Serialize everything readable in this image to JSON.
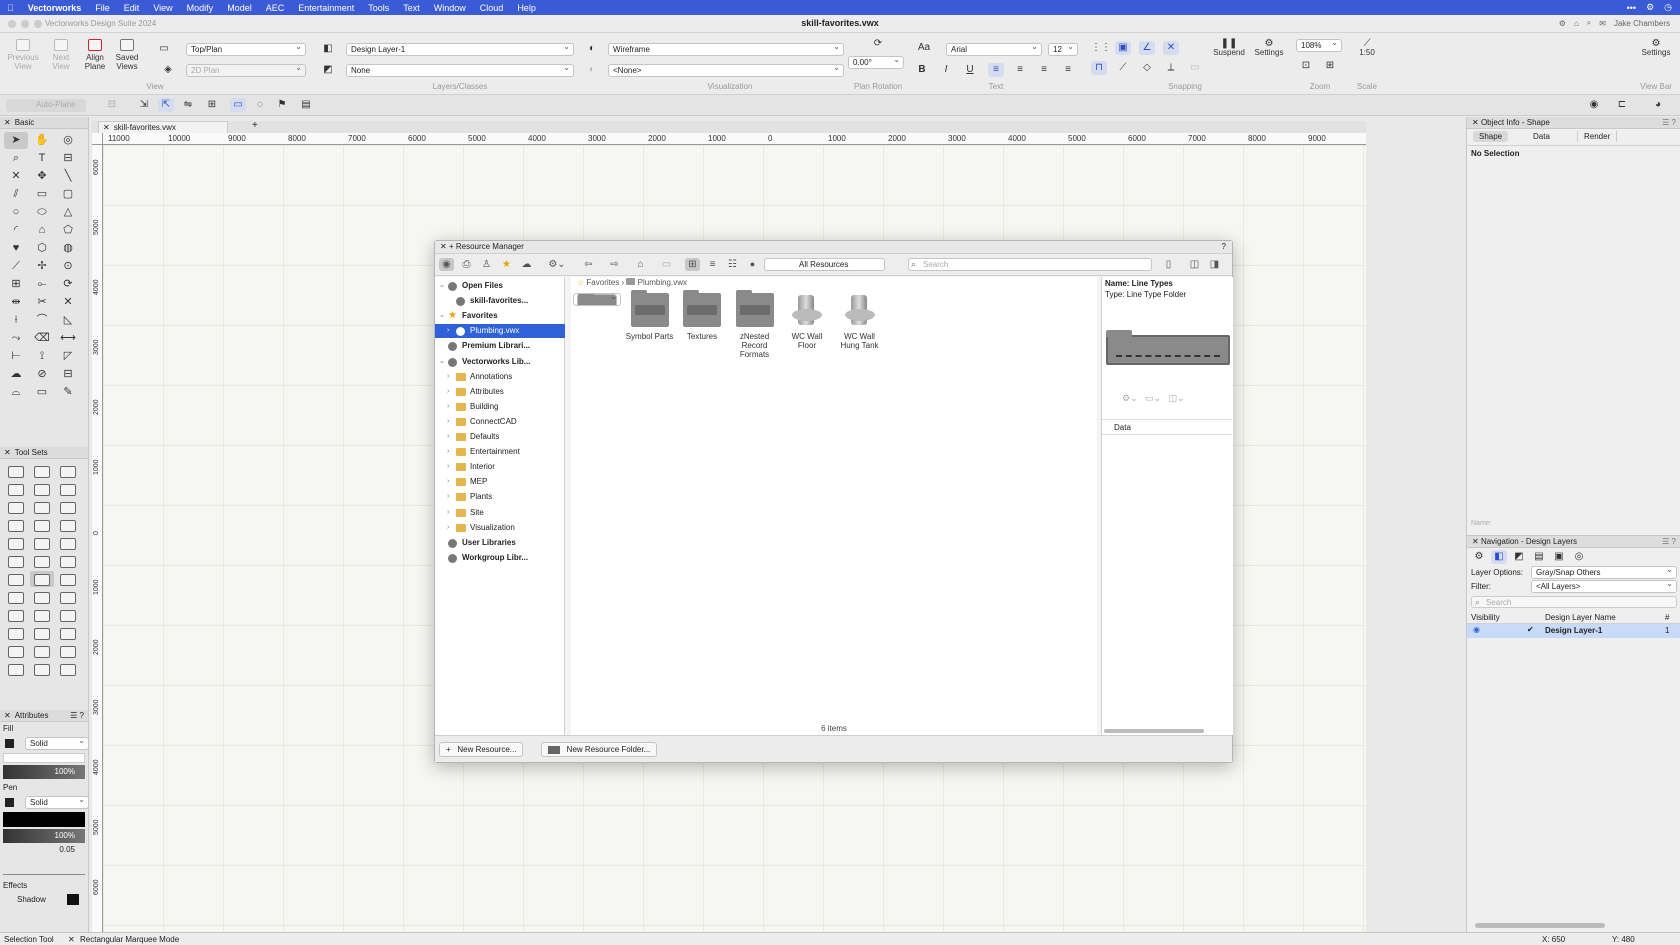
{
  "menubar": {
    "app": "Vectorworks",
    "items": [
      "File",
      "Edit",
      "View",
      "Modify",
      "Model",
      "AEC",
      "Entertainment",
      "Tools",
      "Text",
      "Window",
      "Cloud",
      "Help"
    ]
  },
  "titlebar": {
    "suite": "Vectorworks Design Suite 2024",
    "file": "skill-favorites.vwx",
    "user": "Jake Chambers"
  },
  "toolbar": {
    "previous_view": "Previous View",
    "next_view": "Next View",
    "align_plane": "Align Plane",
    "saved_views": "Saved Views",
    "view_select": "Top/Plan",
    "render_mode": "2D Plan",
    "layer_select": "Design Layer-1",
    "class_select": "None",
    "render_select": "Wireframe",
    "viz_select": "<None>",
    "plan_rotation": "0.00°",
    "font": "Arial",
    "font_size": "12",
    "suspend": "Suspend",
    "settings": "Settings",
    "zoom": "108%",
    "scale": "1:50",
    "view_bar_settings": "Settings",
    "groups": {
      "view": "View",
      "layers": "Layers/Classes",
      "viz": "Visualization",
      "rotation": "Plan Rotation",
      "text": "Text",
      "snapping": "Snapping",
      "zoom": "Zoom",
      "scale": "Scale",
      "viewbar": "View Bar"
    }
  },
  "modebar": {
    "auto_plane": "Auto-Plane"
  },
  "palettes": {
    "basic": "Basic",
    "toolsets": "Tool Sets",
    "attributes": "Attributes"
  },
  "attributes": {
    "fill": "Fill",
    "fill_style": "Solid",
    "fill_opacity": "100%",
    "pen": "Pen",
    "pen_style": "Solid",
    "pen_opacity": "100%",
    "thickness": "0.05",
    "effects": "Effects",
    "shadow": "Shadow"
  },
  "doc_tab": "skill-favorites.vwx",
  "ruler": {
    "h": [
      "11000",
      "10000",
      "9000",
      "8000",
      "7000",
      "6000",
      "5000",
      "4000",
      "3000",
      "2000",
      "1000",
      "0",
      "1000",
      "2000",
      "3000",
      "4000",
      "5000",
      "6000",
      "7000",
      "8000",
      "9000",
      "10000",
      "11000"
    ],
    "v": [
      "6000",
      "5000",
      "4000",
      "3000",
      "2000",
      "1000",
      "0",
      "1000",
      "2000",
      "3000",
      "4000",
      "5000",
      "6000"
    ]
  },
  "resource_manager": {
    "title": "Resource Manager",
    "help": "?",
    "filter": "All Resources",
    "search_placeholder": "Search",
    "tree": [
      {
        "label": "Open Files",
        "level": 0,
        "bold": true,
        "caret": "⌄"
      },
      {
        "label": "skill-favorites...",
        "level": 1,
        "bold": true
      },
      {
        "label": "Favorites",
        "level": 0,
        "bold": true,
        "caret": "⌄"
      },
      {
        "label": "Plumbing.vwx",
        "level": 1,
        "selected": true,
        "caret": "›"
      },
      {
        "label": "Premium Librari...",
        "level": 0,
        "bold": true
      },
      {
        "label": "Vectorworks Lib...",
        "level": 0,
        "bold": true,
        "caret": "⌄"
      },
      {
        "label": "Annotations",
        "level": 1,
        "caret": "›"
      },
      {
        "label": "Attributes",
        "level": 1,
        "caret": "›"
      },
      {
        "label": "Building",
        "level": 1,
        "caret": "›"
      },
      {
        "label": "ConnectCAD",
        "level": 1,
        "caret": "›"
      },
      {
        "label": "Defaults",
        "level": 1,
        "caret": "›"
      },
      {
        "label": "Entertainment",
        "level": 1,
        "caret": "›"
      },
      {
        "label": "Interior",
        "level": 1,
        "caret": "›"
      },
      {
        "label": "MEP",
        "level": 1,
        "caret": "›"
      },
      {
        "label": "Plants",
        "level": 1,
        "caret": "›"
      },
      {
        "label": "Site",
        "level": 1,
        "caret": "›"
      },
      {
        "label": "Visualization",
        "level": 1,
        "caret": "›"
      },
      {
        "label": "User Libraries",
        "level": 0,
        "bold": true
      },
      {
        "label": "Workgroup Libr...",
        "level": 0,
        "bold": true
      }
    ],
    "breadcrumb": [
      "Favorites",
      "Plumbing.vwx"
    ],
    "items": [
      {
        "label": "Line Types",
        "kind": "folder",
        "selected": true
      },
      {
        "label": "Symbol Parts",
        "kind": "symbol"
      },
      {
        "label": "Textures",
        "kind": "texture"
      },
      {
        "label": "zNested Record Formats",
        "kind": "record"
      },
      {
        "label": "WC Wall Floor",
        "kind": "wc"
      },
      {
        "label": "WC Wall Hung Tank",
        "kind": "wc2"
      }
    ],
    "count": "6 items",
    "preview_name": "Name: Line Types",
    "preview_type": "Type: Line Type Folder",
    "data_label": "Data",
    "new_resource": "New Resource...",
    "new_folder": "New Resource Folder..."
  },
  "object_info": {
    "title": "Object Info - Shape",
    "tabs": [
      "Shape",
      "Data",
      "Render"
    ],
    "no_selection": "No Selection",
    "name_label": "Name:"
  },
  "navigation": {
    "title": "Navigation - Design Layers",
    "layer_options_label": "Layer Options:",
    "layer_options": "Gray/Snap Others",
    "filter_label": "Filter:",
    "filter": "<All Layers>",
    "search_placeholder": "Search",
    "col_visibility": "Visibility",
    "col_name": "Design Layer Name",
    "col_num": "#",
    "row_name": "Design Layer-1",
    "row_num": "1"
  },
  "status": {
    "tool": "Selection Tool",
    "mode": "Rectangular Marquee Mode",
    "x": "X: 650",
    "y": "Y: 480"
  }
}
